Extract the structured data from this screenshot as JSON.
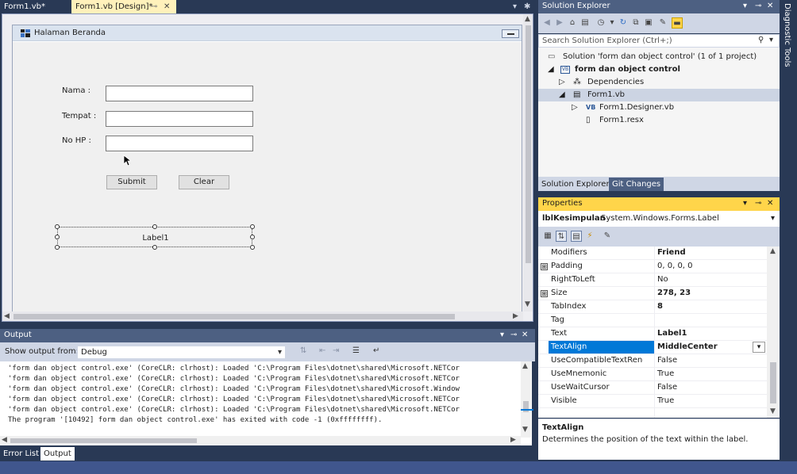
{
  "doc_tabs": [
    {
      "label": "Form1.vb*",
      "active": false
    },
    {
      "label": "Form1.vb [Design]*",
      "active": true
    }
  ],
  "form": {
    "title": "Halaman Beranda",
    "labels": {
      "nama": "Nama :",
      "tempat": "Tempat :",
      "nohp": "No HP :"
    },
    "buttons": {
      "submit": "Submit",
      "clear": "Clear"
    },
    "selected_label": "Label1"
  },
  "output": {
    "title": "Output",
    "show_from_label": "Show output from:",
    "show_from_value": "Debug",
    "lines": [
      "'form dan object control.exe' (CoreCLR: clrhost): Loaded 'C:\\Program Files\\dotnet\\shared\\Microsoft.NETCor",
      "'form dan object control.exe' (CoreCLR: clrhost): Loaded 'C:\\Program Files\\dotnet\\shared\\Microsoft.NETCor",
      "'form dan object control.exe' (CoreCLR: clrhost): Loaded 'C:\\Program Files\\dotnet\\shared\\Microsoft.Window",
      "'form dan object control.exe' (CoreCLR: clrhost): Loaded 'C:\\Program Files\\dotnet\\shared\\Microsoft.NETCor",
      "'form dan object control.exe' (CoreCLR: clrhost): Loaded 'C:\\Program Files\\dotnet\\shared\\Microsoft.NETCor",
      "The program '[10492] form dan object control.exe' has exited with code -1 (0xffffffff)."
    ]
  },
  "bottom_tabs": [
    {
      "label": "Error List",
      "active": false
    },
    {
      "label": "Output",
      "active": true
    }
  ],
  "solution_explorer": {
    "title": "Solution Explorer",
    "search_placeholder": "Search Solution Explorer (Ctrl+;)",
    "tree": [
      {
        "label": "Solution 'form dan object control' (1 of 1 project)",
        "icon": "solution-icon",
        "bold": false
      },
      {
        "label": "form dan object control",
        "icon": "vb-project-icon",
        "bold": true
      },
      {
        "label": "Dependencies",
        "icon": "dependencies-icon",
        "bold": false
      },
      {
        "label": "Form1.vb",
        "icon": "form-file-icon",
        "bold": false
      },
      {
        "label": "Form1.Designer.vb",
        "icon": "vb-file-icon",
        "bold": false
      },
      {
        "label": "Form1.resx",
        "icon": "resx-file-icon",
        "bold": false
      }
    ],
    "vb_badge": "VB",
    "tabs": [
      {
        "label": "Solution Explorer",
        "active": true
      },
      {
        "label": "Git Changes",
        "active": false
      }
    ]
  },
  "properties": {
    "title": "Properties",
    "object_name": "lblKesimpulan",
    "object_type": "System.Windows.Forms.Label",
    "rows": [
      {
        "name": "Modifiers",
        "value": "Friend",
        "bold": true
      },
      {
        "name": "Padding",
        "value": "0, 0, 0, 0",
        "bold": false
      },
      {
        "name": "RightToLeft",
        "value": "No",
        "bold": false
      },
      {
        "name": "Size",
        "value": "278, 23",
        "bold": true
      },
      {
        "name": "TabIndex",
        "value": "8",
        "bold": true
      },
      {
        "name": "Tag",
        "value": "",
        "bold": false
      },
      {
        "name": "Text",
        "value": "Label1",
        "bold": true
      },
      {
        "name": "TextAlign",
        "value": "MiddleCenter",
        "bold": true
      },
      {
        "name": "UseCompatibleTextRenderir",
        "value": "False",
        "bold": false
      },
      {
        "name": "UseMnemonic",
        "value": "True",
        "bold": false
      },
      {
        "name": "UseWaitCursor",
        "value": "False",
        "bold": false
      },
      {
        "name": "Visible",
        "value": "True",
        "bold": false
      }
    ],
    "expander_symbol": "⊞",
    "desc_title": "TextAlign",
    "desc_text": "Determines the position of the text within the label."
  },
  "side_strip": {
    "label": "Diagnostic Tools"
  },
  "colors": {
    "accent": "#0078d7",
    "header": "#4d6082",
    "active_tab": "#fff1bb",
    "prop_header": "#ffd54a"
  }
}
